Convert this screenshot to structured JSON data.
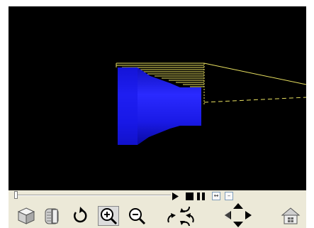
{
  "viewer": {
    "background_color": "#000000",
    "model_color": "#1a1aff",
    "toolpath_color": "#e8e060"
  },
  "playback": {
    "progress": 0.0,
    "step_forward_label": "↔",
    "step_back_label": "–"
  },
  "toolbar": {
    "icons": [
      "isometric-view-icon",
      "section-view-icon",
      "rotate-icon",
      "zoom-in-icon",
      "zoom-out-icon",
      "rotate-view-cluster-icon",
      "pan-cluster-icon",
      "home-icon"
    ]
  }
}
